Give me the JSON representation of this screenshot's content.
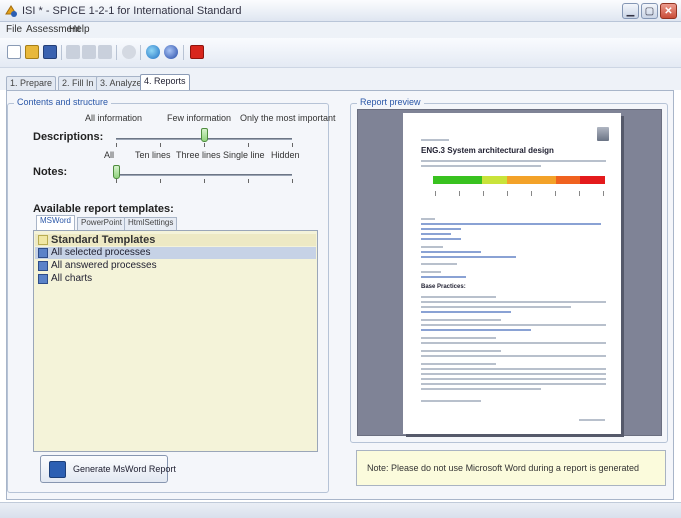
{
  "window": {
    "title": "ISI * - SPICE 1-2-1 for International Standard",
    "icons": [
      "app-icon",
      "minimize-icon",
      "maximize-icon",
      "close-icon"
    ]
  },
  "menu": [
    "File",
    "Assessment",
    "Help"
  ],
  "toolbar": {
    "icons": [
      "new-icon",
      "open-icon",
      "save-icon",
      "cut-icon",
      "undo-icon",
      "redo-icon",
      "filter-icon",
      "globe-icon",
      "help-icon",
      "pdf-icon"
    ]
  },
  "steps": {
    "tabs": [
      "1. Prepare",
      "2. Fill In",
      "3. Analyze",
      "4. Reports"
    ],
    "active": "4. Reports"
  },
  "contents": {
    "legend": "Contents and structure",
    "top_labels": [
      "All information",
      "Few information",
      "Only the most important"
    ],
    "descriptions": {
      "label": "Descriptions:",
      "level": 0.5,
      "tick_labels": [
        "All",
        "Ten lines",
        "Three lines",
        "Single line",
        "Hidden"
      ]
    },
    "notes": {
      "label": "Notes:",
      "level": 0.0
    }
  },
  "templates": {
    "title": "Available report templates:",
    "tabs": [
      "MSWord",
      "PowerPoint",
      "HtmlSettings"
    ],
    "active_tab": "MSWord",
    "rows": [
      {
        "label": "Standard Templates",
        "kind": "header"
      },
      {
        "label": "All selected processes",
        "kind": "item",
        "selected": true
      },
      {
        "label": "All answered processes",
        "kind": "item",
        "selected": false
      },
      {
        "label": "All charts",
        "kind": "item",
        "selected": false
      }
    ]
  },
  "generate_button": "Generate MsWord Report",
  "preview": {
    "legend": "Report preview",
    "heading": "ENG.3 System architectural design",
    "subheading": "Base Practices:",
    "scale_colors": [
      "#39c21f",
      "#39c21f",
      "#c9e33a",
      "#f3a229",
      "#f3a229",
      "#f0621f",
      "#e41a1c"
    ]
  },
  "note": "Note: Please do not use Microsoft Word during a report is generated",
  "colors": {
    "accent_blue": "#2a57a8",
    "list_background": "#f4f3d9",
    "note_background": "#fbfbdc",
    "selection": "#c6d2e6"
  }
}
